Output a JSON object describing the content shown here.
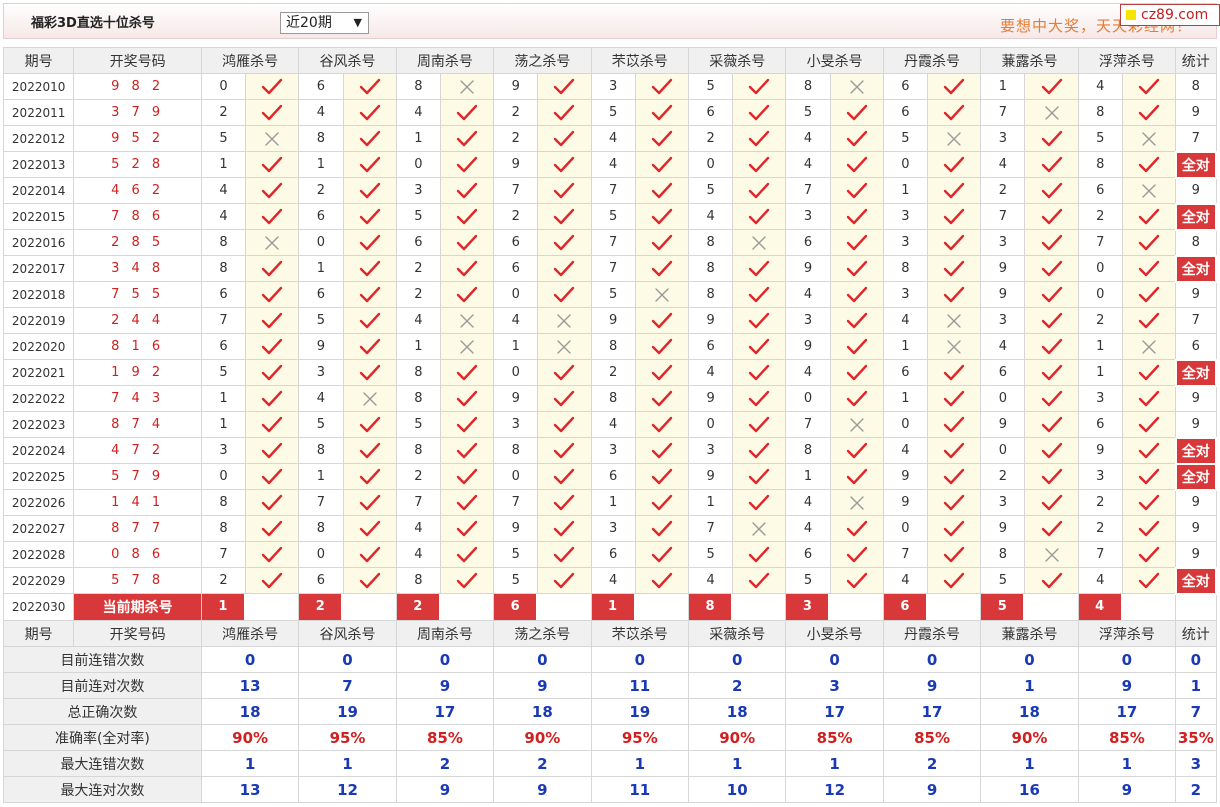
{
  "title": "福彩3D直选十位杀号",
  "period_select": {
    "value": "近20期"
  },
  "ad": {
    "text": "要想中大奖，天天彩经网！",
    "badge": "cz89.com"
  },
  "columns": {
    "issue": "期号",
    "draw": "开奖号码",
    "experts": [
      "鸿雁杀号",
      "谷风杀号",
      "周南杀号",
      "荡之杀号",
      "芣苡杀号",
      "采薇杀号",
      "小旻杀号",
      "丹霞杀号",
      "蒹露杀号",
      "浮萍杀号"
    ],
    "stat": "统计"
  },
  "rows": [
    {
      "issue": "2022010",
      "draw": "9 8 2",
      "picks": [
        [
          "0",
          "y"
        ],
        [
          "6",
          "y"
        ],
        [
          "8",
          "n"
        ],
        [
          "9",
          "y"
        ],
        [
          "3",
          "y"
        ],
        [
          "5",
          "y"
        ],
        [
          "8",
          "n"
        ],
        [
          "6",
          "y"
        ],
        [
          "1",
          "y"
        ],
        [
          "4",
          "y"
        ]
      ],
      "stat": "8"
    },
    {
      "issue": "2022011",
      "draw": "3 7 9",
      "picks": [
        [
          "2",
          "y"
        ],
        [
          "4",
          "y"
        ],
        [
          "4",
          "y"
        ],
        [
          "2",
          "y"
        ],
        [
          "5",
          "y"
        ],
        [
          "6",
          "y"
        ],
        [
          "5",
          "y"
        ],
        [
          "6",
          "y"
        ],
        [
          "7",
          "n"
        ],
        [
          "8",
          "y"
        ]
      ],
      "stat": "9"
    },
    {
      "issue": "2022012",
      "draw": "9 5 2",
      "picks": [
        [
          "5",
          "n"
        ],
        [
          "8",
          "y"
        ],
        [
          "1",
          "y"
        ],
        [
          "2",
          "y"
        ],
        [
          "4",
          "y"
        ],
        [
          "2",
          "y"
        ],
        [
          "4",
          "y"
        ],
        [
          "5",
          "n"
        ],
        [
          "3",
          "y"
        ],
        [
          "5",
          "n"
        ]
      ],
      "stat": "7"
    },
    {
      "issue": "2022013",
      "draw": "5 2 8",
      "picks": [
        [
          "1",
          "y"
        ],
        [
          "1",
          "y"
        ],
        [
          "0",
          "y"
        ],
        [
          "9",
          "y"
        ],
        [
          "4",
          "y"
        ],
        [
          "0",
          "y"
        ],
        [
          "4",
          "y"
        ],
        [
          "0",
          "y"
        ],
        [
          "4",
          "y"
        ],
        [
          "8",
          "y"
        ]
      ],
      "stat": "全对"
    },
    {
      "issue": "2022014",
      "draw": "4 6 2",
      "picks": [
        [
          "4",
          "y"
        ],
        [
          "2",
          "y"
        ],
        [
          "3",
          "y"
        ],
        [
          "7",
          "y"
        ],
        [
          "7",
          "y"
        ],
        [
          "5",
          "y"
        ],
        [
          "7",
          "y"
        ],
        [
          "1",
          "y"
        ],
        [
          "2",
          "y"
        ],
        [
          "6",
          "n"
        ]
      ],
      "stat": "9"
    },
    {
      "issue": "2022015",
      "draw": "7 8 6",
      "picks": [
        [
          "4",
          "y"
        ],
        [
          "6",
          "y"
        ],
        [
          "5",
          "y"
        ],
        [
          "2",
          "y"
        ],
        [
          "5",
          "y"
        ],
        [
          "4",
          "y"
        ],
        [
          "3",
          "y"
        ],
        [
          "3",
          "y"
        ],
        [
          "7",
          "y"
        ],
        [
          "2",
          "y"
        ]
      ],
      "stat": "全对"
    },
    {
      "issue": "2022016",
      "draw": "2 8 5",
      "picks": [
        [
          "8",
          "n"
        ],
        [
          "0",
          "y"
        ],
        [
          "6",
          "y"
        ],
        [
          "6",
          "y"
        ],
        [
          "7",
          "y"
        ],
        [
          "8",
          "n"
        ],
        [
          "6",
          "y"
        ],
        [
          "3",
          "y"
        ],
        [
          "3",
          "y"
        ],
        [
          "7",
          "y"
        ]
      ],
      "stat": "8"
    },
    {
      "issue": "2022017",
      "draw": "3 4 8",
      "picks": [
        [
          "8",
          "y"
        ],
        [
          "1",
          "y"
        ],
        [
          "2",
          "y"
        ],
        [
          "6",
          "y"
        ],
        [
          "7",
          "y"
        ],
        [
          "8",
          "y"
        ],
        [
          "9",
          "y"
        ],
        [
          "8",
          "y"
        ],
        [
          "9",
          "y"
        ],
        [
          "0",
          "y"
        ]
      ],
      "stat": "全对"
    },
    {
      "issue": "2022018",
      "draw": "7 5 5",
      "picks": [
        [
          "6",
          "y"
        ],
        [
          "6",
          "y"
        ],
        [
          "2",
          "y"
        ],
        [
          "0",
          "y"
        ],
        [
          "5",
          "n"
        ],
        [
          "8",
          "y"
        ],
        [
          "4",
          "y"
        ],
        [
          "3",
          "y"
        ],
        [
          "9",
          "y"
        ],
        [
          "0",
          "y"
        ]
      ],
      "stat": "9"
    },
    {
      "issue": "2022019",
      "draw": "2 4 4",
      "picks": [
        [
          "7",
          "y"
        ],
        [
          "5",
          "y"
        ],
        [
          "4",
          "n"
        ],
        [
          "4",
          "n"
        ],
        [
          "9",
          "y"
        ],
        [
          "9",
          "y"
        ],
        [
          "3",
          "y"
        ],
        [
          "4",
          "n"
        ],
        [
          "3",
          "y"
        ],
        [
          "2",
          "y"
        ]
      ],
      "stat": "7"
    },
    {
      "issue": "2022020",
      "draw": "8 1 6",
      "picks": [
        [
          "6",
          "y"
        ],
        [
          "9",
          "y"
        ],
        [
          "1",
          "n"
        ],
        [
          "1",
          "n"
        ],
        [
          "8",
          "y"
        ],
        [
          "6",
          "y"
        ],
        [
          "9",
          "y"
        ],
        [
          "1",
          "n"
        ],
        [
          "4",
          "y"
        ],
        [
          "1",
          "n"
        ]
      ],
      "stat": "6"
    },
    {
      "issue": "2022021",
      "draw": "1 9 2",
      "picks": [
        [
          "5",
          "y"
        ],
        [
          "3",
          "y"
        ],
        [
          "8",
          "y"
        ],
        [
          "0",
          "y"
        ],
        [
          "2",
          "y"
        ],
        [
          "4",
          "y"
        ],
        [
          "4",
          "y"
        ],
        [
          "6",
          "y"
        ],
        [
          "6",
          "y"
        ],
        [
          "1",
          "y"
        ]
      ],
      "stat": "全对"
    },
    {
      "issue": "2022022",
      "draw": "7 4 3",
      "picks": [
        [
          "1",
          "y"
        ],
        [
          "4",
          "n"
        ],
        [
          "8",
          "y"
        ],
        [
          "9",
          "y"
        ],
        [
          "8",
          "y"
        ],
        [
          "9",
          "y"
        ],
        [
          "0",
          "y"
        ],
        [
          "1",
          "y"
        ],
        [
          "0",
          "y"
        ],
        [
          "3",
          "y"
        ]
      ],
      "stat": "9"
    },
    {
      "issue": "2022023",
      "draw": "8 7 4",
      "picks": [
        [
          "1",
          "y"
        ],
        [
          "5",
          "y"
        ],
        [
          "5",
          "y"
        ],
        [
          "3",
          "y"
        ],
        [
          "4",
          "y"
        ],
        [
          "0",
          "y"
        ],
        [
          "7",
          "n"
        ],
        [
          "0",
          "y"
        ],
        [
          "9",
          "y"
        ],
        [
          "6",
          "y"
        ]
      ],
      "stat": "9"
    },
    {
      "issue": "2022024",
      "draw": "4 7 2",
      "picks": [
        [
          "3",
          "y"
        ],
        [
          "8",
          "y"
        ],
        [
          "8",
          "y"
        ],
        [
          "8",
          "y"
        ],
        [
          "3",
          "y"
        ],
        [
          "3",
          "y"
        ],
        [
          "8",
          "y"
        ],
        [
          "4",
          "y"
        ],
        [
          "0",
          "y"
        ],
        [
          "9",
          "y"
        ]
      ],
      "stat": "全对"
    },
    {
      "issue": "2022025",
      "draw": "5 7 9",
      "picks": [
        [
          "0",
          "y"
        ],
        [
          "1",
          "y"
        ],
        [
          "2",
          "y"
        ],
        [
          "0",
          "y"
        ],
        [
          "6",
          "y"
        ],
        [
          "9",
          "y"
        ],
        [
          "1",
          "y"
        ],
        [
          "9",
          "y"
        ],
        [
          "2",
          "y"
        ],
        [
          "3",
          "y"
        ]
      ],
      "stat": "全对"
    },
    {
      "issue": "2022026",
      "draw": "1 4 1",
      "picks": [
        [
          "8",
          "y"
        ],
        [
          "7",
          "y"
        ],
        [
          "7",
          "y"
        ],
        [
          "7",
          "y"
        ],
        [
          "1",
          "y"
        ],
        [
          "1",
          "y"
        ],
        [
          "4",
          "n"
        ],
        [
          "9",
          "y"
        ],
        [
          "3",
          "y"
        ],
        [
          "2",
          "y"
        ]
      ],
      "stat": "9"
    },
    {
      "issue": "2022027",
      "draw": "8 7 7",
      "picks": [
        [
          "8",
          "y"
        ],
        [
          "8",
          "y"
        ],
        [
          "4",
          "y"
        ],
        [
          "9",
          "y"
        ],
        [
          "3",
          "y"
        ],
        [
          "7",
          "n"
        ],
        [
          "4",
          "y"
        ],
        [
          "0",
          "y"
        ],
        [
          "9",
          "y"
        ],
        [
          "2",
          "y"
        ]
      ],
      "stat": "9"
    },
    {
      "issue": "2022028",
      "draw": "0 8 6",
      "picks": [
        [
          "7",
          "y"
        ],
        [
          "0",
          "y"
        ],
        [
          "4",
          "y"
        ],
        [
          "5",
          "y"
        ],
        [
          "6",
          "y"
        ],
        [
          "5",
          "y"
        ],
        [
          "6",
          "y"
        ],
        [
          "7",
          "y"
        ],
        [
          "8",
          "n"
        ],
        [
          "7",
          "y"
        ]
      ],
      "stat": "9"
    },
    {
      "issue": "2022029",
      "draw": "5 7 8",
      "picks": [
        [
          "2",
          "y"
        ],
        [
          "6",
          "y"
        ],
        [
          "8",
          "y"
        ],
        [
          "5",
          "y"
        ],
        [
          "4",
          "y"
        ],
        [
          "4",
          "y"
        ],
        [
          "5",
          "y"
        ],
        [
          "4",
          "y"
        ],
        [
          "5",
          "y"
        ],
        [
          "4",
          "y"
        ]
      ],
      "stat": "全对"
    }
  ],
  "current": {
    "issue": "2022030",
    "label": "当前期杀号",
    "picks": [
      "1",
      "2",
      "2",
      "6",
      "1",
      "8",
      "3",
      "6",
      "5",
      "4"
    ]
  },
  "summary": [
    {
      "label": "目前连错次数",
      "values": [
        "0",
        "0",
        "0",
        "0",
        "0",
        "0",
        "0",
        "0",
        "0",
        "0"
      ],
      "stat": "0"
    },
    {
      "label": "目前连对次数",
      "values": [
        "13",
        "7",
        "9",
        "9",
        "11",
        "2",
        "3",
        "9",
        "1",
        "9"
      ],
      "stat": "1"
    },
    {
      "label": "总正确次数",
      "values": [
        "18",
        "19",
        "17",
        "18",
        "19",
        "18",
        "17",
        "17",
        "18",
        "17"
      ],
      "stat": "7"
    },
    {
      "label": "准确率(全对率)",
      "values": [
        "90%",
        "95%",
        "85%",
        "90%",
        "95%",
        "90%",
        "85%",
        "85%",
        "90%",
        "85%"
      ],
      "stat": "35%",
      "pct": true
    },
    {
      "label": "最大连错次数",
      "values": [
        "1",
        "1",
        "2",
        "2",
        "1",
        "1",
        "1",
        "2",
        "1",
        "1"
      ],
      "stat": "3"
    },
    {
      "label": "最大连对次数",
      "values": [
        "13",
        "12",
        "9",
        "9",
        "11",
        "10",
        "12",
        "9",
        "16",
        "9"
      ],
      "stat": "2"
    }
  ],
  "colors": {
    "accent_red": "#d9383a",
    "check_red": "#e0262a",
    "cross_gray": "#9a9a9a",
    "value_blue": "#1a3ab5"
  }
}
